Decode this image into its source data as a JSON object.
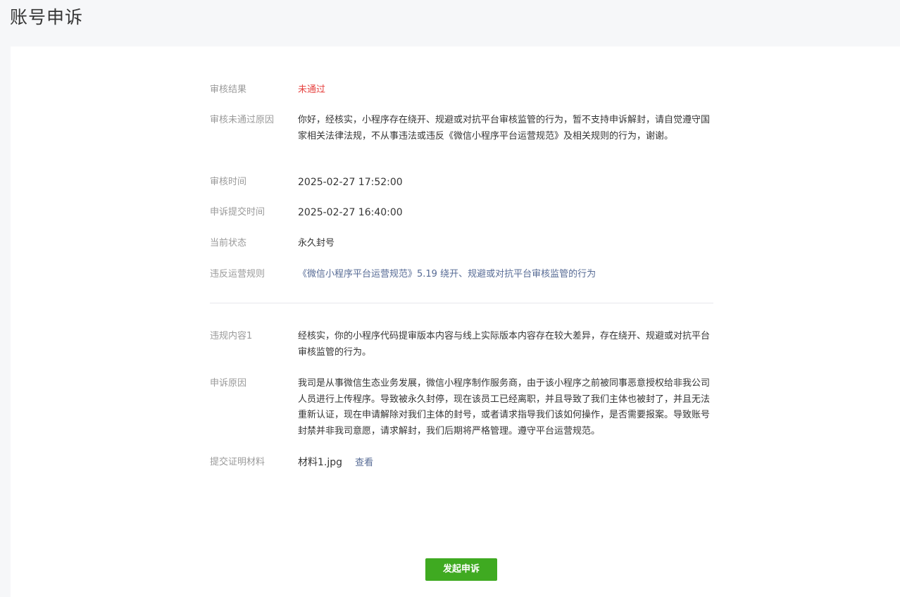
{
  "page": {
    "title": "账号申诉"
  },
  "review": {
    "result": {
      "label": "审核结果",
      "value": "未通过"
    },
    "reason": {
      "label": "审核未通过原因",
      "value": "你好，经核实，小程序存在绕开、规避或对抗平台审核监管的行为，暂不支持申诉解封，请自觉遵守国家相关法律法规，不从事违法或违反《微信小程序平台运营规范》及相关规则的行为，谢谢。"
    },
    "review_time": {
      "label": "审核时间",
      "value": "2025-02-27 17:52:00"
    },
    "submit_time": {
      "label": "申诉提交时间",
      "value": "2025-02-27 16:40:00"
    },
    "status": {
      "label": "当前状态",
      "value": "永久封号"
    },
    "rule": {
      "label": "违反运营规则",
      "value": "《微信小程序平台运营规范》5.19 绕开、规避或对抗平台审核监管的行为"
    }
  },
  "appeal": {
    "violation": {
      "label": "违规内容1",
      "value": "经核实，你的小程序代码提审版本内容与线上实际版本内容存在较大差异，存在绕开、规避或对抗平台审核监管的行为。"
    },
    "appeal_reason": {
      "label": "申诉原因",
      "value": "我司是从事微信生态业务发展，微信小程序制作服务商，由于该小程序之前被同事恶意授权给非我公司人员进行上传程序。导致被永久封停，现在该员工已经离职，并且导致了我们主体也被封了，并且无法重新认证，现在申请解除对我们主体的封号，或者请求指导我们该如何操作，是否需要报案。导致账号封禁并非我司意愿，请求解封，我们后期将严格管理。遵守平台运营规范。"
    },
    "evidence": {
      "label": "提交证明材料",
      "file_name": "材料1.jpg",
      "view_label": "查看"
    }
  },
  "actions": {
    "appeal_button": "发起申诉"
  },
  "colors": {
    "fail": "#e64340",
    "link": "#576b95",
    "primary_button": "#3faa21"
  }
}
